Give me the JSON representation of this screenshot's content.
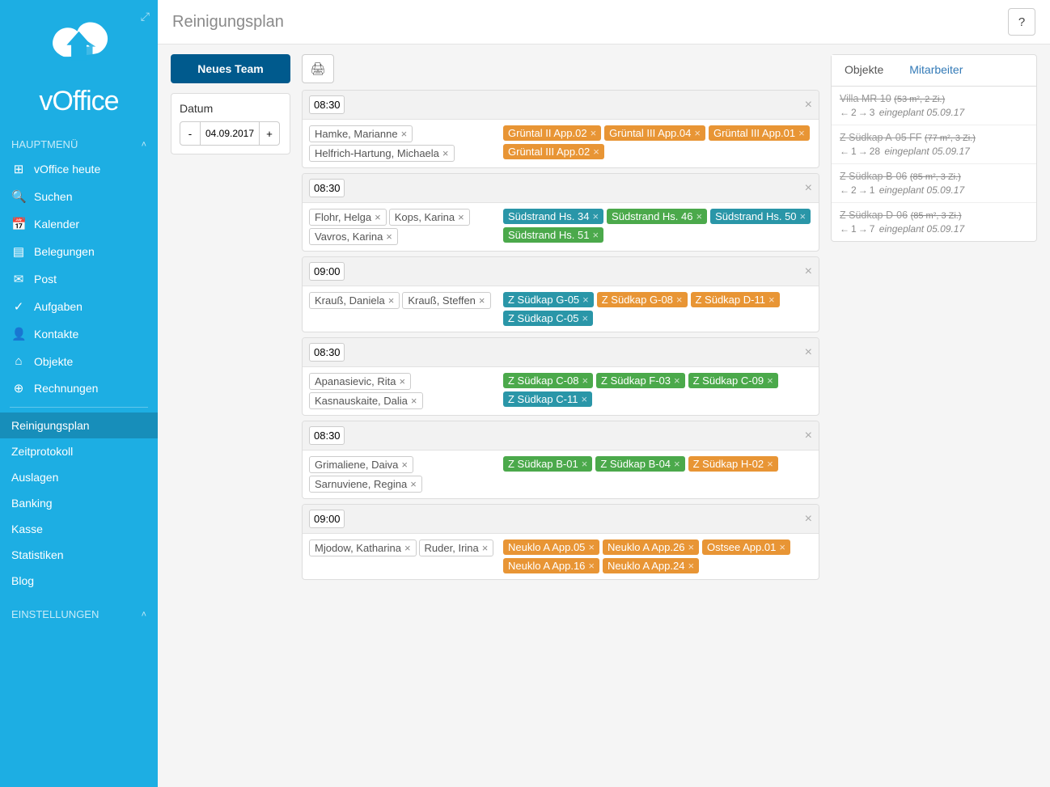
{
  "app": {
    "brand": "vOffice",
    "pageTitle": "Reinigungsplan"
  },
  "sidebar": {
    "section1": "HAUPTMENÜ",
    "section2": "EINSTELLUNGEN",
    "items": [
      {
        "label": "vOffice heute",
        "icon": "⊞"
      },
      {
        "label": "Suchen",
        "icon": "🔍"
      },
      {
        "label": "Kalender",
        "icon": "📅"
      },
      {
        "label": "Belegungen",
        "icon": "▤"
      },
      {
        "label": "Post",
        "icon": "✉"
      },
      {
        "label": "Aufgaben",
        "icon": "✓"
      },
      {
        "label": "Kontakte",
        "icon": "👤"
      },
      {
        "label": "Objekte",
        "icon": "⌂"
      },
      {
        "label": "Rechnungen",
        "icon": "⊕"
      }
    ],
    "items2": [
      {
        "label": "Reinigungsplan"
      },
      {
        "label": "Zeitprotokoll"
      },
      {
        "label": "Auslagen"
      },
      {
        "label": "Banking"
      },
      {
        "label": "Kasse"
      },
      {
        "label": "Statistiken"
      },
      {
        "label": "Blog"
      }
    ]
  },
  "leftPanel": {
    "newTeam": "Neues Team",
    "dateLabel": "Datum",
    "dateValue": "04.09.2017",
    "minus": "-",
    "plus": "+"
  },
  "teams": [
    {
      "time": "08:30",
      "people": [
        "Hamke, Marianne",
        "Helfrich-Hartung, Michaela"
      ],
      "objects": [
        {
          "name": "Grüntal II App.02",
          "color": "c-orange"
        },
        {
          "name": "Grüntal III App.04",
          "color": "c-orange"
        },
        {
          "name": "Grüntal III App.01",
          "color": "c-orange"
        },
        {
          "name": "Grüntal III App.02",
          "color": "c-orange"
        }
      ]
    },
    {
      "time": "08:30",
      "people": [
        "Flohr, Helga",
        "Kops, Karina",
        "Vavros, Karina"
      ],
      "objects": [
        {
          "name": "Südstrand Hs. 34",
          "color": "c-teal"
        },
        {
          "name": "Südstrand Hs. 46",
          "color": "c-green"
        },
        {
          "name": "Südstrand Hs. 50",
          "color": "c-teal"
        },
        {
          "name": "Südstrand Hs. 51",
          "color": "c-green"
        }
      ]
    },
    {
      "time": "09:00",
      "people": [
        "Krauß, Daniela",
        "Krauß, Steffen"
      ],
      "objects": [
        {
          "name": "Z Südkap G-05",
          "color": "c-teal"
        },
        {
          "name": "Z Südkap G-08",
          "color": "c-orange"
        },
        {
          "name": "Z Südkap D-11",
          "color": "c-orange"
        },
        {
          "name": "Z Südkap C-05",
          "color": "c-teal"
        }
      ]
    },
    {
      "time": "08:30",
      "people": [
        "Apanasievic, Rita",
        "Kasnauskaite, Dalia"
      ],
      "objects": [
        {
          "name": "Z Südkap C-08",
          "color": "c-green"
        },
        {
          "name": "Z Südkap F-03",
          "color": "c-green"
        },
        {
          "name": "Z Südkap C-09",
          "color": "c-green"
        },
        {
          "name": "Z Südkap C-11",
          "color": "c-teal"
        }
      ]
    },
    {
      "time": "08:30",
      "people": [
        "Grimaliene, Daiva",
        "Sarnuviene, Regina"
      ],
      "objects": [
        {
          "name": "Z Südkap B-01",
          "color": "c-green"
        },
        {
          "name": "Z Südkap B-04",
          "color": "c-green"
        },
        {
          "name": "Z Südkap H-02",
          "color": "c-orange"
        }
      ]
    },
    {
      "time": "09:00",
      "people": [
        "Mjodow, Katharina",
        "Ruder, Irina"
      ],
      "objects": [
        {
          "name": "Neuklo A App.05",
          "color": "c-orange"
        },
        {
          "name": "Neuklo A App.26",
          "color": "c-orange"
        },
        {
          "name": "Ostsee App.01",
          "color": "c-orange"
        },
        {
          "name": "Neuklo A App.16",
          "color": "c-orange"
        },
        {
          "name": "Neuklo A App.24",
          "color": "c-orange"
        }
      ]
    }
  ],
  "right": {
    "tab1": "Objekte",
    "tab2": "Mitarbeiter",
    "objects": [
      {
        "title": "Villa MR 10",
        "meta": "(53 m², 2 Zi.)",
        "in": "2",
        "out": "3",
        "note": "eingeplant 05.09.17"
      },
      {
        "title": "Z Südkap A-05 FF",
        "meta": "(77 m², 3 Zi.)",
        "in": "1",
        "out": "28",
        "note": "eingeplant 05.09.17"
      },
      {
        "title": "Z Südkap B-06",
        "meta": "(85 m², 3 Zi.)",
        "in": "2",
        "out": "1",
        "note": "eingeplant 05.09.17"
      },
      {
        "title": "Z Südkap D-06",
        "meta": "(85 m², 3 Zi.)",
        "in": "1",
        "out": "7",
        "note": "eingeplant 05.09.17"
      }
    ]
  },
  "icons": {
    "help": "?",
    "print": "🖨",
    "close": "×",
    "remove": "×",
    "chevUp": "˄",
    "arrowL": "←",
    "arrowR": "→",
    "expand": "⤢"
  }
}
